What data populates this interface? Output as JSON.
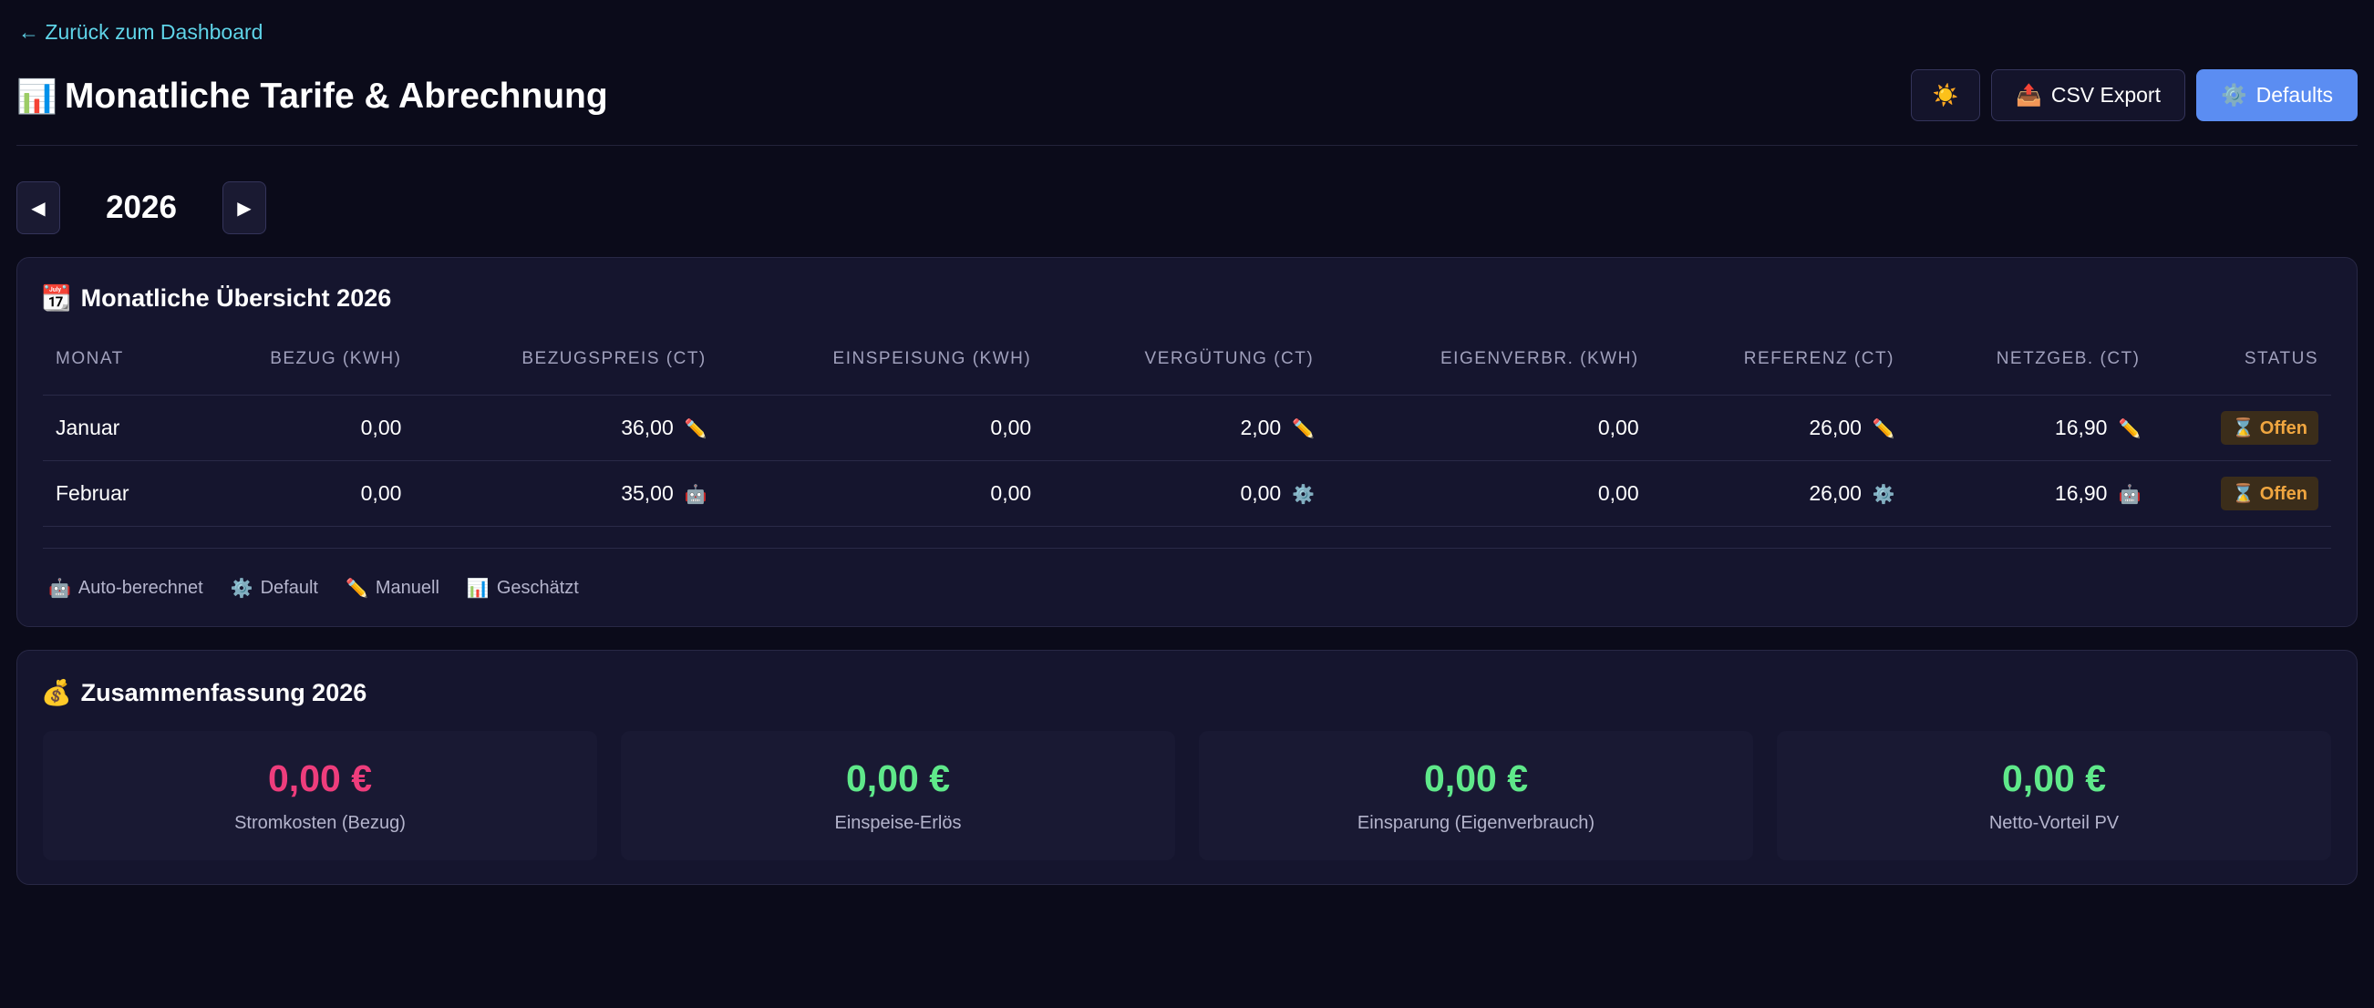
{
  "nav": {
    "back_label": "← Zurück zum Dashboard"
  },
  "header": {
    "title_icon": "📊",
    "title": "Monatliche Tarife & Abrechnung",
    "theme_icon": "☀️",
    "csv_icon": "📤",
    "csv_label": "CSV Export",
    "defaults_icon": "⚙️",
    "defaults_label": "Defaults"
  },
  "year_nav": {
    "prev": "◀",
    "year": "2026",
    "next": "▶"
  },
  "overview": {
    "icon": "📆",
    "title": "Monatliche Übersicht 2026",
    "columns": [
      "Monat",
      "Bezug (kWh)",
      "Bezugspreis (ct)",
      "Einspeisung (kWh)",
      "Vergütung (ct)",
      "Eigenverbr. (kWh)",
      "Referenz (ct)",
      "Netzgeb. (ct)",
      "Status"
    ],
    "rows": [
      {
        "month": "Januar",
        "bezug": "0,00",
        "bezugspreis": "36,00",
        "bezugspreis_src": "✏️",
        "einspeisung": "0,00",
        "verguetung": "2,00",
        "verguetung_src": "✏️",
        "eigenverbr": "0,00",
        "referenz": "26,00",
        "referenz_src": "✏️",
        "netzgeb": "16,90",
        "netzgeb_src": "✏️",
        "status_icon": "⌛",
        "status": "Offen"
      },
      {
        "month": "Februar",
        "bezug": "0,00",
        "bezugspreis": "35,00",
        "bezugspreis_src": "🤖",
        "einspeisung": "0,00",
        "verguetung": "0,00",
        "verguetung_src": "⚙️",
        "eigenverbr": "0,00",
        "referenz": "26,00",
        "referenz_src": "⚙️",
        "netzgeb": "16,90",
        "netzgeb_src": "🤖",
        "status_icon": "⌛",
        "status": "Offen"
      }
    ],
    "legend": [
      {
        "icon": "🤖",
        "label": "Auto-berechnet"
      },
      {
        "icon": "⚙️",
        "label": "Default"
      },
      {
        "icon": "✏️",
        "label": "Manuell"
      },
      {
        "icon": "📊",
        "label": "Geschätzt"
      }
    ]
  },
  "summary": {
    "icon": "💰",
    "title": "Zusammenfassung 2026",
    "items": [
      {
        "value": "0,00 €",
        "label": "Stromkosten (Bezug)",
        "color": "#ee3d7c"
      },
      {
        "value": "0,00 €",
        "label": "Einspeise-Erlös",
        "color": "#5fe88a"
      },
      {
        "value": "0,00 €",
        "label": "Einsparung (Eigenverbrauch)",
        "color": "#5fe88a"
      },
      {
        "value": "0,00 €",
        "label": "Netto-Vorteil PV",
        "color": "#5fe88a"
      }
    ]
  },
  "colors": {
    "accent": "#5b8df2",
    "link": "#5fd4e8",
    "negative": "#ee3d7c",
    "positive": "#5fe88a",
    "status_open": "#f0a640"
  }
}
